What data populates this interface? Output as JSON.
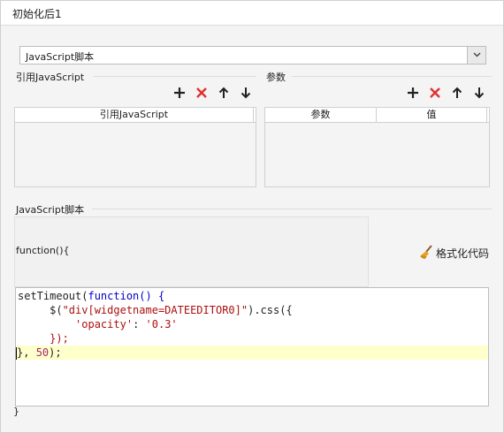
{
  "window": {
    "title": "初始化后1"
  },
  "script_type": {
    "selected": "JavaScript脚本"
  },
  "ref_section": {
    "label": "引用JavaScript",
    "columns": [
      "引用JavaScript"
    ]
  },
  "param_section": {
    "label": "参数",
    "columns": [
      "参数",
      "值"
    ]
  },
  "toolbar": {
    "add_icon": "plus-icon",
    "delete_icon": "red-x-icon",
    "up_icon": "arrow-up-icon",
    "down_icon": "arrow-down-icon"
  },
  "script_section": {
    "label": "JavaScript脚本",
    "function_header": "function(){",
    "closing_brace": "}",
    "format_button": "格式化代码",
    "format_icon": "broom-icon"
  },
  "code": {
    "line1": [
      "setTimeout(",
      "function",
      "() {"
    ],
    "line2": [
      "$(",
      "\"div[widgetname=DATEEDITOR0]\"",
      ").css({"
    ],
    "line3": [
      "'opacity'",
      ": ",
      "'0.3'"
    ],
    "line4": [
      "});"
    ],
    "line5": [
      "}, ",
      "50",
      ");"
    ]
  },
  "colors": {
    "keyword": "#0000cc",
    "string": "#aa1111",
    "current_line": "#ffffcc",
    "delete": "#e03030"
  }
}
